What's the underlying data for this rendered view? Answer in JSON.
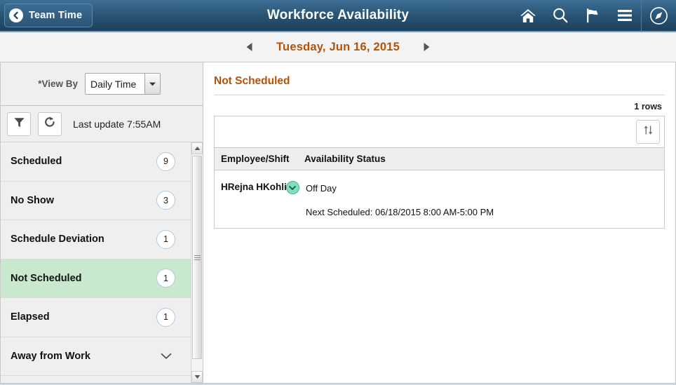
{
  "header": {
    "back_label": "Team Time",
    "title": "Workforce Availability",
    "icons": [
      {
        "name": "home-icon",
        "label": "Home"
      },
      {
        "name": "search-icon",
        "label": "Search"
      },
      {
        "name": "flag-icon",
        "label": "Notifications"
      },
      {
        "name": "hamburger-menu-icon",
        "label": "Actions"
      },
      {
        "name": "navbar-compass-icon",
        "label": "NavBar"
      }
    ],
    "bg_color": "#2b5777"
  },
  "datebar": {
    "prev_label": "Previous day",
    "date": "Tuesday, Jun 16, 2015",
    "next_label": "Next day",
    "date_color": "#b35309"
  },
  "left_panel": {
    "view_by_label": "*View By",
    "view_by_value": "Daily Time",
    "view_by_options": [
      "Daily Time"
    ],
    "filter_label": "Filter",
    "refresh_label": "Refresh",
    "last_update": "Last update 7:55AM",
    "items": [
      {
        "label": "Scheduled",
        "count": "9",
        "selected": false,
        "has_chevron": false
      },
      {
        "label": "No Show",
        "count": "3",
        "selected": false,
        "has_chevron": false
      },
      {
        "label": "Schedule Deviation",
        "count": "1",
        "selected": false,
        "has_chevron": false
      },
      {
        "label": "Not Scheduled",
        "count": "1",
        "selected": true,
        "has_chevron": false
      },
      {
        "label": "Elapsed",
        "count": "1",
        "selected": false,
        "has_chevron": false
      },
      {
        "label": "Away from Work",
        "count": "",
        "selected": false,
        "has_chevron": true
      }
    ],
    "selected_color": "#c9e9ce"
  },
  "main": {
    "section_title": "Not Scheduled",
    "rows_count": "1 rows",
    "sort_label": "Sort",
    "columns": [
      "Employee/Shift",
      "Availability Status"
    ],
    "rows": [
      {
        "employee": "HRejna HKohli",
        "status": "Off Day",
        "next_scheduled": "Next Scheduled: 06/18/2015 8:00 AM-5:00 PM"
      }
    ]
  }
}
